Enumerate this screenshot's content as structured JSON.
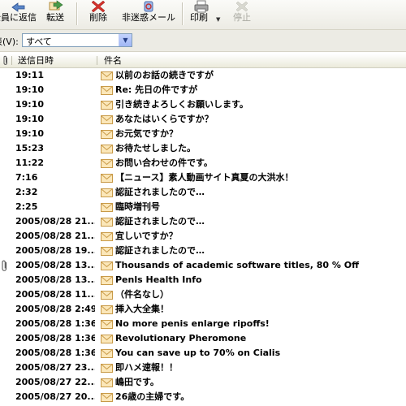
{
  "toolbar": {
    "reply_all_label": "全員に返信",
    "forward_label": "転送",
    "delete_label": "削除",
    "junk_label": "非迷惑メール",
    "print_label": "印刷",
    "stop_label": "停止"
  },
  "filter": {
    "label": "表(V):",
    "value": "すべて"
  },
  "columns": {
    "date": "送信日時",
    "subject": "件名"
  },
  "messages": [
    {
      "date": "19:11",
      "subject": "以前のお話の続きですが",
      "attachment": false
    },
    {
      "date": "19:10",
      "subject": "Re: 先日の件ですが",
      "attachment": false
    },
    {
      "date": "19:10",
      "subject": "引き続きよろしくお願いします。",
      "attachment": false
    },
    {
      "date": "19:10",
      "subject": "あなたはいくらですか？",
      "attachment": false
    },
    {
      "date": "19:10",
      "subject": "お元気ですか？",
      "attachment": false
    },
    {
      "date": "15:23",
      "subject": "お待たせしました。",
      "attachment": false
    },
    {
      "date": "11:22",
      "subject": "お問い合わせの件です。",
      "attachment": false
    },
    {
      "date": "7:16",
      "subject": "【ニュース】素人動画サイト真夏の大洪水！",
      "attachment": false
    },
    {
      "date": "2:32",
      "subject": "認証されましたので…",
      "attachment": false
    },
    {
      "date": "2:25",
      "subject": "臨時増刊号",
      "attachment": false
    },
    {
      "date": "2005/08/28 21...",
      "subject": "認証されましたので…",
      "attachment": false
    },
    {
      "date": "2005/08/28 21...",
      "subject": "宜しいですか？",
      "attachment": false
    },
    {
      "date": "2005/08/28 19...",
      "subject": "認証されましたので…",
      "attachment": false
    },
    {
      "date": "2005/08/28 13...",
      "subject": "Thousands of academic software titles, 80 % Off",
      "attachment": true
    },
    {
      "date": "2005/08/28 13...",
      "subject": "Penls Health Info",
      "attachment": false
    },
    {
      "date": "2005/08/28 11...",
      "subject": "（件名なし）",
      "attachment": false
    },
    {
      "date": "2005/08/28 2:49",
      "subject": "挿入大全集！",
      "attachment": false
    },
    {
      "date": "2005/08/28 1:36",
      "subject": "No more penis enlarge ripoffs!",
      "attachment": false
    },
    {
      "date": "2005/08/28 1:36",
      "subject": "Revolutionary Pheromone",
      "attachment": false
    },
    {
      "date": "2005/08/28 1:36",
      "subject": "You can save up to 70% on Cialis",
      "attachment": false
    },
    {
      "date": "2005/08/27 23...",
      "subject": "即ハメ速報！！",
      "attachment": false
    },
    {
      "date": "2005/08/27 22...",
      "subject": "嶋田です。",
      "attachment": false
    },
    {
      "date": "2005/08/27 20...",
      "subject": "26歳の主婦です。",
      "attachment": false
    }
  ],
  "colors": {
    "toolbar_bg": "#ecebe4",
    "select_border": "#7f9db9",
    "envelope": "#f1c27d"
  },
  "icons": {
    "reply_all": "reply-all-icon",
    "forward": "forward-icon",
    "delete": "delete-x-icon",
    "junk": "not-junk-icon",
    "print": "printer-icon",
    "stop": "stop-icon",
    "message": "envelope-icon",
    "attachment": "paperclip-icon"
  }
}
